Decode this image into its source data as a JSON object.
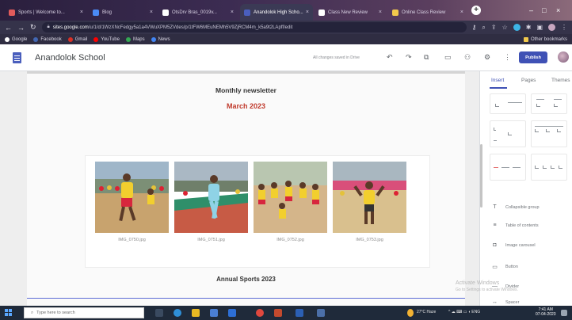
{
  "browser": {
    "tabs": [
      {
        "title": "Sports | Welcome to...",
        "color": "#e25b5b",
        "active": false
      },
      {
        "title": "Blog",
        "color": "#4a8af4",
        "active": false
      },
      {
        "title": "OtsDrv Bras_0019v...",
        "color": "#ffffff",
        "active": false
      },
      {
        "title": "Anandolok High Scho...",
        "color": "#4a5fbd",
        "active": true
      },
      {
        "title": "Class New Review",
        "color": "#ffffff",
        "active": false
      },
      {
        "title": "Online Class Review",
        "color": "#f2c94c",
        "active": false
      }
    ],
    "new_tab": "+",
    "url_host": "sites.google.com",
    "url_path": "/u/1/d/1WzXNcFedgy5a1a4VWuXPM5ZVdes/p/1tFW6MEuNEMh5V9ZjRCM4m_k5a9t2LApff/edit",
    "bookmarks": [
      {
        "label": "Google",
        "color": "#ffffff"
      },
      {
        "label": "Facebook",
        "color": "#4267b2"
      },
      {
        "label": "Gmail",
        "color": "#d93025"
      },
      {
        "label": "YouTube",
        "color": "#ff0000"
      },
      {
        "label": "Maps",
        "color": "#34a853"
      },
      {
        "label": "News",
        "color": "#4285f4"
      }
    ],
    "other_bookmarks": "Other bookmarks"
  },
  "editor": {
    "site_name": "Anandolok School",
    "save_status": "All changes saved in Drive",
    "publish_label": "Publish"
  },
  "page": {
    "newsletter_title": "Monthly newsletter",
    "newsletter_date": "March 2023",
    "images": [
      {
        "caption": "IMG_0750.jpg"
      },
      {
        "caption": "IMG_0751.jpg"
      },
      {
        "caption": "IMG_0752.jpg"
      },
      {
        "caption": "IMG_0753.jpg"
      }
    ],
    "section_title": "Annual Sports 2023"
  },
  "panel": {
    "tabs": [
      "Insert",
      "Pages",
      "Themes"
    ],
    "active_tab": "Insert",
    "components": [
      {
        "icon": "collapsible-group-icon",
        "glyph": "T",
        "label": "Collapsible group"
      },
      {
        "icon": "table-of-contents-icon",
        "glyph": "≡",
        "label": "Table of contents"
      },
      {
        "icon": "image-carousel-icon",
        "glyph": "◘",
        "label": "Image carousel"
      },
      {
        "icon": "button-icon",
        "glyph": "▭",
        "label": "Button"
      },
      {
        "icon": "divider-icon",
        "glyph": "—",
        "label": "Divider"
      },
      {
        "icon": "spacer-icon",
        "glyph": "↔",
        "label": "Spacer"
      }
    ]
  },
  "watermark": {
    "line1": "Activate Windows",
    "line2": "Go to Settings to activate Windows."
  },
  "taskbar": {
    "search_placeholder": "Type here to search",
    "tray_text": "27°C  Haze",
    "time": "7:41 AM",
    "date": "07-04-2023"
  },
  "colors": {
    "accent": "#3f51b5",
    "date_red": "#c0392b"
  }
}
